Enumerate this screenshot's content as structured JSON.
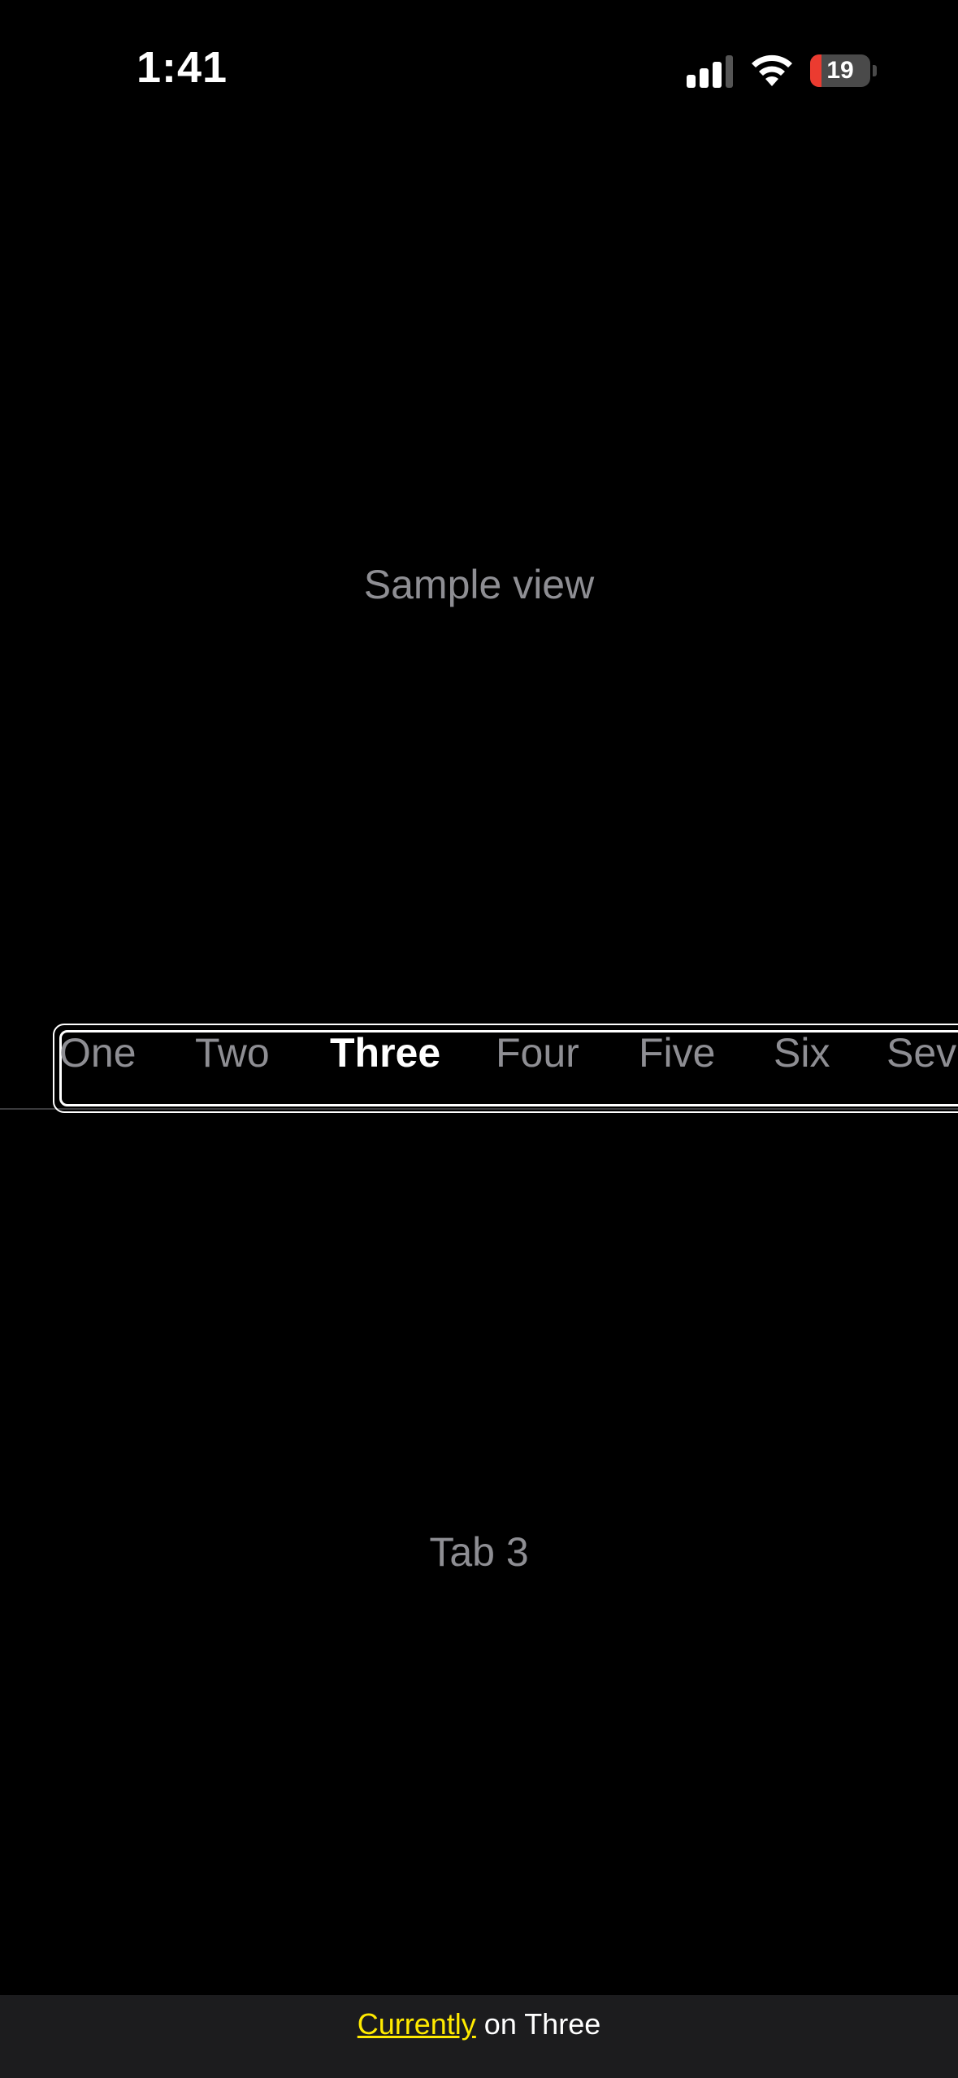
{
  "status_bar": {
    "time": "1:41",
    "battery_level": "19",
    "battery_fraction": 0.19,
    "battery_color": "#eb3b30",
    "signal_bars_active": 3,
    "signal_bars_total": 4,
    "icons": [
      "signal-icon",
      "wifi-icon",
      "battery-icon"
    ]
  },
  "main": {
    "sample_label": "Sample view"
  },
  "tabs": {
    "items": [
      {
        "label": "One",
        "selected": false
      },
      {
        "label": "Two",
        "selected": false
      },
      {
        "label": "Three",
        "selected": true
      },
      {
        "label": "Four",
        "selected": false
      },
      {
        "label": "Five",
        "selected": false
      },
      {
        "label": "Six",
        "selected": false
      },
      {
        "label": "Seven",
        "selected": false
      }
    ],
    "content": "Tab 3"
  },
  "bottom_bar": {
    "link_text": "Currently",
    "suffix": " on Three",
    "link_color": "#ffea00"
  }
}
